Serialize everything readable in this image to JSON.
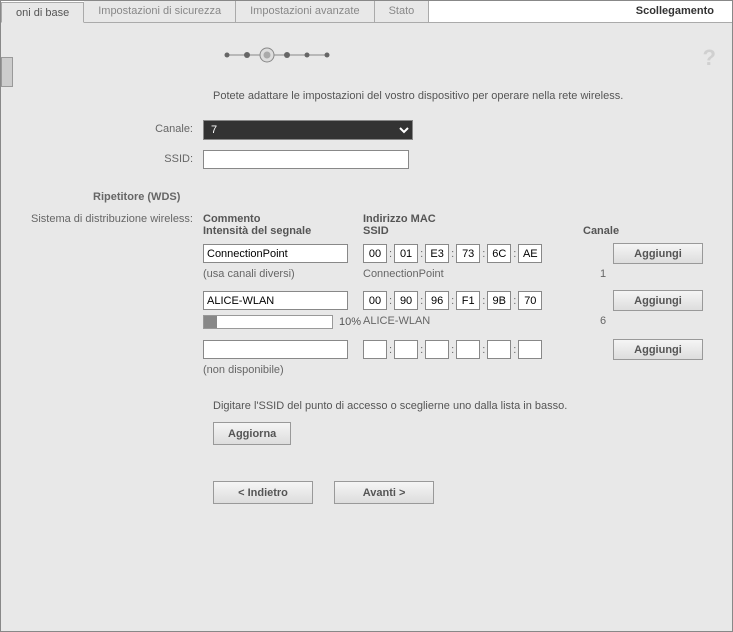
{
  "tabs": {
    "basic": "oni di base",
    "security": "Impostazioni di sicurezza",
    "advanced": "Impostazioni avanzate",
    "status": "Stato"
  },
  "logout": "Scollegamento",
  "intro": "Potete adattare le impostazioni del vostro dispositivo per operare nella rete wireless.",
  "labels": {
    "channel": "Canale:",
    "ssid": "SSID:",
    "repeater": "Ripetitore (WDS)",
    "wds": "Sistema di distribuzione wireless:"
  },
  "channel_value": "7",
  "ssid_value": "",
  "wds": {
    "headers": {
      "comment": "Commento",
      "mac": "Indirizzo MAC",
      "strength": "Intensità del segnale",
      "ssid": "SSID",
      "channel": "Canale"
    },
    "rows": [
      {
        "comment": "ConnectionPoint",
        "mac": [
          "00",
          "01",
          "E3",
          "73",
          "6C",
          "AE"
        ],
        "note": "(usa canali diversi)",
        "info_ssid": "ConnectionPoint",
        "info_channel": "1",
        "strength_pct": null
      },
      {
        "comment": "ALICE-WLAN",
        "mac": [
          "00",
          "90",
          "96",
          "F1",
          "9B",
          "70"
        ],
        "note": "",
        "info_ssid": "ALICE-WLAN",
        "info_channel": "6",
        "strength_pct": "10%"
      },
      {
        "comment": "",
        "mac": [
          "",
          "",
          "",
          "",
          "",
          ""
        ],
        "note": "(non disponibile)",
        "info_ssid": "",
        "info_channel": "",
        "strength_pct": null
      }
    ],
    "add_label": "Aggiungi"
  },
  "ssid_hint": "Digitare l'SSID del punto di accesso o sceglierne uno dalla lista in basso.",
  "buttons": {
    "refresh": "Aggiorna",
    "back": "< Indietro",
    "next": "Avanti >"
  }
}
